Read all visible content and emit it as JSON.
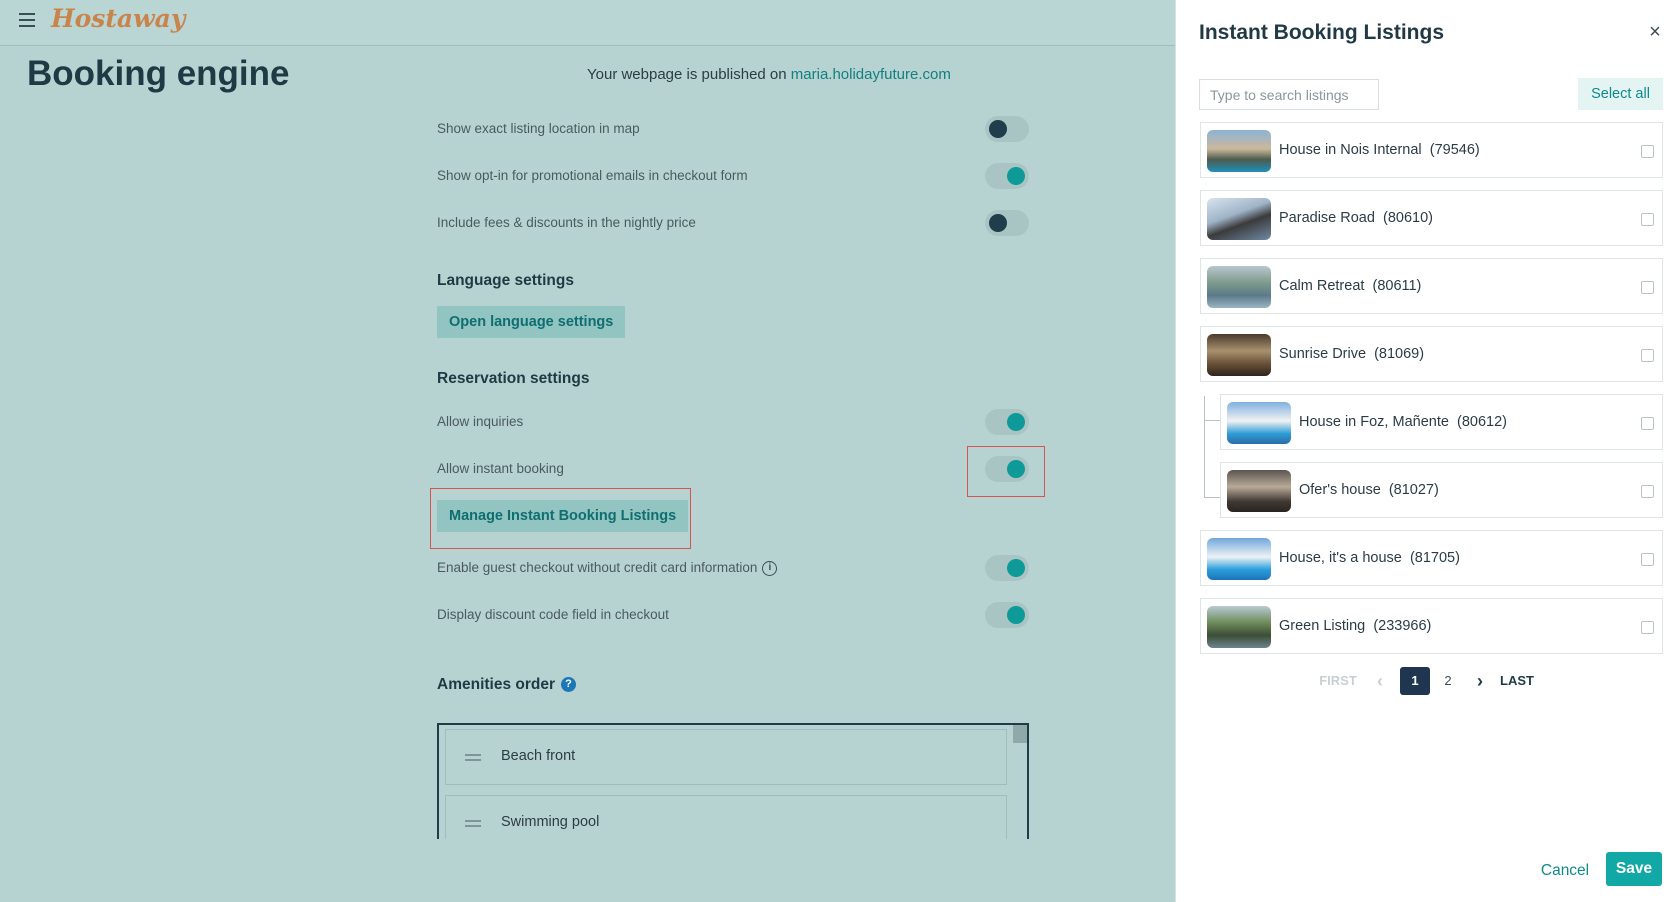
{
  "app": {
    "logo": "Hostaway"
  },
  "page": {
    "title": "Booking engine",
    "publish_prefix": "Your webpage is published on",
    "publish_link": "maria.holidayfuture.com"
  },
  "settings": [
    {
      "label": "Show exact listing location in map",
      "enabled": false
    },
    {
      "label": "Show opt-in for promotional emails in checkout form",
      "enabled": true
    },
    {
      "label": "Include fees & discounts in the nightly price",
      "enabled": false
    }
  ],
  "language": {
    "title": "Language settings",
    "button": "Open language settings"
  },
  "reservation": {
    "title": "Reservation settings",
    "allow_inquiries": {
      "label": "Allow inquiries",
      "enabled": true
    },
    "allow_instant_booking": {
      "label": "Allow instant booking",
      "enabled": true
    },
    "manage_button": "Manage Instant Booking Listings",
    "guest_checkout": {
      "label": "Enable guest checkout without credit card information",
      "info_icon": "info-icon",
      "info_glyph": "i",
      "enabled": true
    },
    "discount_code": {
      "label": "Display discount code field in checkout",
      "enabled": true
    }
  },
  "amenities": {
    "title": "Amenities order",
    "help_icon": "help-icon",
    "help_glyph": "?",
    "items": [
      "Beach front",
      "Swimming pool"
    ]
  },
  "panel": {
    "title": "Instant Booking Listings",
    "close_glyph": "×",
    "search_placeholder": "Type to search listings",
    "select_all": "Select all",
    "listings": [
      {
        "name": "House in Nois Internal",
        "id": "(79546)",
        "child": false,
        "checked": false
      },
      {
        "name": "Paradise Road",
        "id": "(80610)",
        "child": false,
        "checked": false
      },
      {
        "name": "Calm Retreat",
        "id": "(80611)",
        "child": false,
        "checked": false
      },
      {
        "name": "Sunrise Drive",
        "id": "(81069)",
        "child": false,
        "checked": false
      },
      {
        "name": "House in Foz, Mañente",
        "id": "(80612)",
        "child": true,
        "checked": false
      },
      {
        "name": "Ofer's house",
        "id": "(81027)",
        "child": true,
        "checked": false
      },
      {
        "name": "House, it's a house",
        "id": "(81705)",
        "child": false,
        "checked": false
      },
      {
        "name": "Green Listing",
        "id": "(233966)",
        "child": false,
        "checked": false
      }
    ],
    "pagination": {
      "first": "FIRST",
      "prev_glyph": "‹",
      "pages": [
        "1",
        "2"
      ],
      "current": "1",
      "next_glyph": "›",
      "last": "LAST"
    },
    "cancel": "Cancel",
    "save": "Save"
  },
  "colors": {
    "accent": "#12a8a6",
    "overlay_bg": "#b7d3d1",
    "highlight_border": "#d9534f",
    "pager_active": "#1f3550"
  }
}
